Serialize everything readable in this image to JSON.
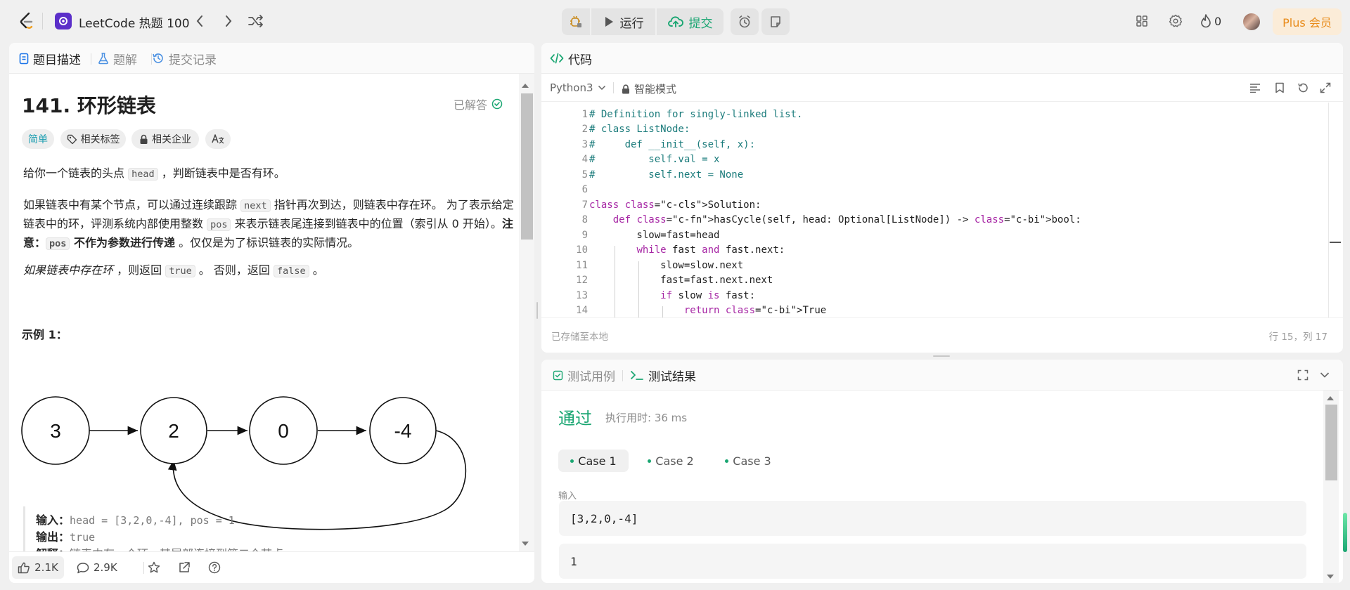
{
  "app": {
    "name": "LeetCode 热题 100"
  },
  "toolbar": {
    "run": "运行",
    "submit": "提交",
    "fire_count": "0",
    "plus": "Plus 会员"
  },
  "left_tabs": [
    "题目描述",
    "题解",
    "提交记录"
  ],
  "problem": {
    "title": "141. 环形链表",
    "status": "已解答",
    "difficulty": "简单",
    "tag_topics": "相关标签",
    "tag_companies": "相关企业",
    "p1_a": "给你一个链表的头点 ",
    "p1_code": "head",
    "p1_b": " ，判断链表中是否有环。",
    "p2_a": "如果链表中有某个节点，可以通过连续跟踪 ",
    "p2_code1": "next",
    "p2_b": " 指针再次到达，则链表中存在环。 为了表示给定链表中的环，评测系统内部使用整数 ",
    "p2_code2": "pos",
    "p2_c": " 来表示链表尾连接到链表中的位置（索引从 0 开始）。",
    "p2_note": "注意：",
    "p2_code3": "pos",
    "p2_bold": " 不作为参数进行传递",
    "p2_d": " 。仅仅是为了标识链表的实际情况。",
    "p3_italic": "如果链表中存在环",
    "p3_a": " ，则返回 ",
    "p3_code1": "true",
    "p3_b": " 。 否则，返回 ",
    "p3_code2": "false",
    "p3_c": " 。",
    "example_title": "示例 1：",
    "diagram_nodes": [
      "3",
      "2",
      "0",
      "-4"
    ],
    "example_input_label": "输入：",
    "example_input": "head = [3,2,0,-4], pos = 1",
    "example_output_label": "输出：",
    "example_output": "true",
    "example_explain_label": "解释：",
    "example_explain": "链表中有一个环，其尾部连接到第二个节点。"
  },
  "footer": {
    "likes": "2.1K",
    "comments": "2.9K"
  },
  "code_panel": {
    "tab": "代码",
    "language": "Python3",
    "mode": "智能模式",
    "saved": "已存储至本地",
    "cursor": "行 15，列 17",
    "lines": [
      {
        "n": "1",
        "text": "# Definition for singly-linked list."
      },
      {
        "n": "2",
        "text": "# class ListNode:"
      },
      {
        "n": "3",
        "text": "#     def __init__(self, x):"
      },
      {
        "n": "4",
        "text": "#         self.val = x"
      },
      {
        "n": "5",
        "text": "#         self.next = None"
      },
      {
        "n": "6",
        "text": ""
      },
      {
        "n": "7",
        "text": "class Solution:"
      },
      {
        "n": "8",
        "text": "    def hasCycle(self, head: Optional[ListNode]) -> bool:"
      },
      {
        "n": "9",
        "text": "        slow=fast=head"
      },
      {
        "n": "10",
        "text": "        while fast and fast.next:"
      },
      {
        "n": "11",
        "text": "            slow=slow.next"
      },
      {
        "n": "12",
        "text": "            fast=fast.next.next"
      },
      {
        "n": "13",
        "text": "            if slow is fast:"
      },
      {
        "n": "14",
        "text": "                return True"
      }
    ]
  },
  "result_panel": {
    "tab_cases": "测试用例",
    "tab_result": "测试结果",
    "status": "通过",
    "runtime": "执行用时: 36 ms",
    "cases": [
      "Case 1",
      "Case 2",
      "Case 3"
    ],
    "input_label": "输入",
    "input_value": "[3,2,0,-4]",
    "pos_value": "1"
  },
  "colors": {
    "accent_green": "#1aa672",
    "submit_green": "#1aa672",
    "plus_orange": "#e88b1a"
  }
}
